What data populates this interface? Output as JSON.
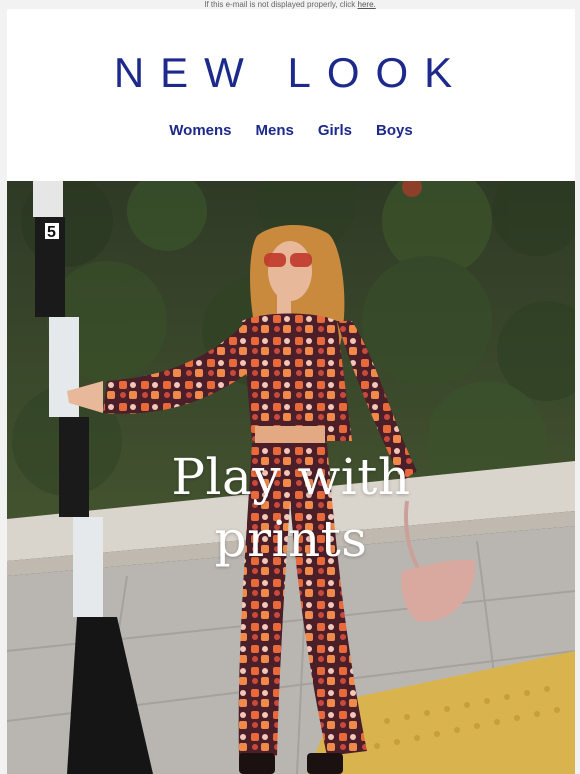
{
  "preheader": {
    "text": "If this e-mail is not displayed properly, click ",
    "link_label": "here."
  },
  "brand": {
    "logo_text": "NEW LOOK",
    "color": "#1d2a8c"
  },
  "nav": {
    "items": [
      {
        "label": "Womens"
      },
      {
        "label": "Mens"
      },
      {
        "label": "Girls"
      },
      {
        "label": "Boys"
      }
    ]
  },
  "hero": {
    "headline_line1": "Play with",
    "headline_line2": "prints",
    "pole_number": "5"
  }
}
